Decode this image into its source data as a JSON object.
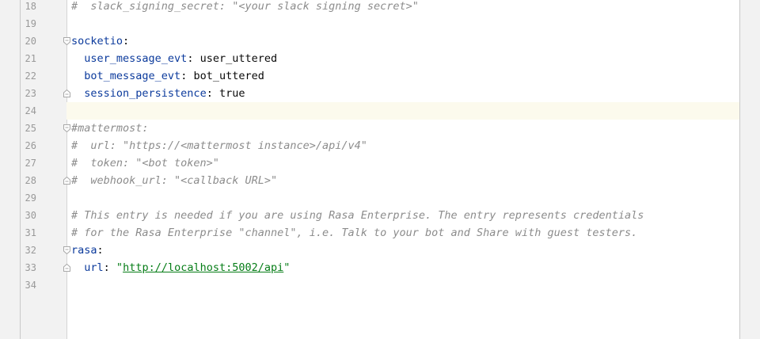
{
  "editor": {
    "lines": [
      {
        "num": "18",
        "fold": "none",
        "parts": [
          {
            "type": "comment",
            "text": "#  slack_signing_secret: \"<your slack signing secret>\""
          }
        ]
      },
      {
        "num": "19",
        "fold": "none",
        "parts": []
      },
      {
        "num": "20",
        "fold": "open",
        "parts": [
          {
            "type": "key",
            "text": "socketio"
          },
          {
            "type": "plain",
            "text": ":"
          }
        ]
      },
      {
        "num": "21",
        "fold": "none",
        "parts": [
          {
            "type": "plain",
            "text": "  "
          },
          {
            "type": "key",
            "text": "user_message_evt"
          },
          {
            "type": "plain",
            "text": ": user_uttered"
          }
        ]
      },
      {
        "num": "22",
        "fold": "none",
        "parts": [
          {
            "type": "plain",
            "text": "  "
          },
          {
            "type": "key",
            "text": "bot_message_evt"
          },
          {
            "type": "plain",
            "text": ": bot_uttered"
          }
        ]
      },
      {
        "num": "23",
        "fold": "close",
        "parts": [
          {
            "type": "plain",
            "text": "  "
          },
          {
            "type": "key",
            "text": "session_persistence"
          },
          {
            "type": "plain",
            "text": ": true"
          }
        ]
      },
      {
        "num": "24",
        "fold": "none",
        "current": true,
        "parts": []
      },
      {
        "num": "25",
        "fold": "open",
        "parts": [
          {
            "type": "comment",
            "text": "#mattermost:"
          }
        ]
      },
      {
        "num": "26",
        "fold": "none",
        "parts": [
          {
            "type": "comment",
            "text": "#  url: \"https://<mattermost instance>/api/v4\""
          }
        ]
      },
      {
        "num": "27",
        "fold": "none",
        "parts": [
          {
            "type": "comment",
            "text": "#  token: \"<bot token>\""
          }
        ]
      },
      {
        "num": "28",
        "fold": "close",
        "parts": [
          {
            "type": "comment",
            "text": "#  webhook_url: \"<callback URL>\""
          }
        ]
      },
      {
        "num": "29",
        "fold": "none",
        "parts": []
      },
      {
        "num": "30",
        "fold": "none",
        "parts": [
          {
            "type": "comment",
            "text": "# This entry is needed if you are using Rasa Enterprise. The entry represents credentials"
          }
        ]
      },
      {
        "num": "31",
        "fold": "none",
        "parts": [
          {
            "type": "comment",
            "text": "# for the Rasa Enterprise \"channel\", i.e. Talk to your bot and Share with guest testers."
          }
        ]
      },
      {
        "num": "32",
        "fold": "open",
        "parts": [
          {
            "type": "key",
            "text": "rasa"
          },
          {
            "type": "plain",
            "text": ":"
          }
        ]
      },
      {
        "num": "33",
        "fold": "close",
        "parts": [
          {
            "type": "plain",
            "text": "  "
          },
          {
            "type": "key",
            "text": "url"
          },
          {
            "type": "plain",
            "text": ": "
          },
          {
            "type": "str",
            "text": "\""
          },
          {
            "type": "link",
            "text": "http://localhost:5002/api"
          },
          {
            "type": "str",
            "text": "\""
          }
        ]
      },
      {
        "num": "34",
        "fold": "none",
        "parts": []
      }
    ]
  },
  "colors": {
    "key": "#0b3a9c",
    "comment": "#8c8c8c",
    "string": "#067d17",
    "current_line": "#fcfaed"
  }
}
